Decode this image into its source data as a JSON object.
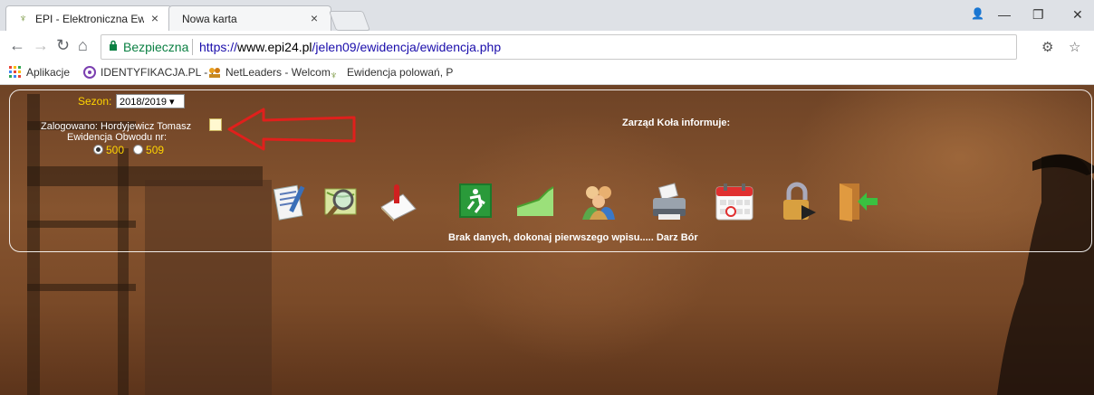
{
  "browser": {
    "tabs": [
      {
        "title": "EPI - Elektroniczna Ewide",
        "close": "×"
      },
      {
        "title": "Nowa karta",
        "close": "×"
      }
    ],
    "secure_label": "Bezpieczna",
    "url_scheme": "https://",
    "url_host": "www.epi24.pl",
    "url_path": "/jelen09/ewidencja/ewidencja.php",
    "bookmarks": [
      {
        "label": "Aplikacje",
        "icon": "apps-grid-icon"
      },
      {
        "label": "IDENTYFIKACJA.PL - I",
        "icon": "identyfikacja-icon"
      },
      {
        "label": "NetLeaders - Welcom",
        "icon": "netleaders-icon"
      },
      {
        "label": "Ewidencja polowań, P",
        "icon": "deer-icon"
      }
    ],
    "window_controls": [
      "—",
      "❐",
      "✕"
    ],
    "colors": {
      "secure": "#0b8043",
      "url": "#1a0dab"
    }
  },
  "page": {
    "sezon_label": "Sezon:",
    "sezon_value": "2018/2019 ▾",
    "logged_in": "Zalogowano: Hordyjewicz Tomasz",
    "ewidencja_label": "Ewidencja Obwodu nr:",
    "obwody": [
      {
        "value": "500",
        "checked": true
      },
      {
        "value": "509",
        "checked": false
      }
    ],
    "zarzad_info": "Zarząd Koła informuje:",
    "toolbar_icons": [
      "notepad-icon",
      "map-search-icon",
      "document-pin-icon",
      "exit-door-green-icon",
      "chart-area-icon",
      "users-group-icon",
      "printer-icon",
      "calendar-icon",
      "padlock-icon",
      "logout-door-icon"
    ],
    "status_message": "Brak danych, dokonaj pierwszego wpisu..... Darz Bór",
    "colors": {
      "accent_yellow": "#ffd400",
      "annotation_arrow": "#e0201c"
    }
  }
}
